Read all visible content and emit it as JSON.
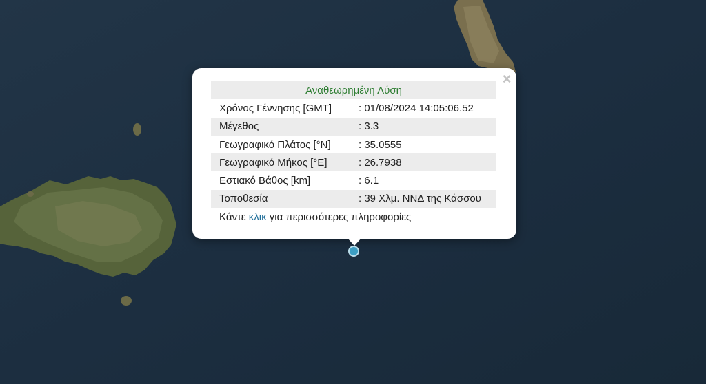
{
  "popup": {
    "title": "Αναθεωρημένη Λύση",
    "rows": [
      {
        "label": "Χρόνος Γέννησης [GMT]",
        "value": ": 01/08/2024 14:05:06.52"
      },
      {
        "label": "Μέγεθος",
        "value": ": 3.3"
      },
      {
        "label": "Γεωγραφικό Πλάτος [°N]",
        "value": ": 35.0555"
      },
      {
        "label": "Γεωγραφικό Μήκος [°E]",
        "value": ": 26.7938"
      },
      {
        "label": "Εστιακό Βάθος [km]",
        "value": ": 6.1"
      },
      {
        "label": "Τοποθεσία",
        "value": ": 39 Χλμ. ΝΝΔ της Κάσσου"
      }
    ],
    "footer": {
      "before": "Κάντε ",
      "link": "κλικ",
      "after": " για περισσότερες πληροφορίες"
    },
    "close_symbol": "×"
  },
  "colors": {
    "sea": "#1d2f41",
    "land": "#5c6a3c",
    "title_green": "#2e7d32",
    "link_blue": "#1f6e9a",
    "marker": "#3c9ec3"
  }
}
